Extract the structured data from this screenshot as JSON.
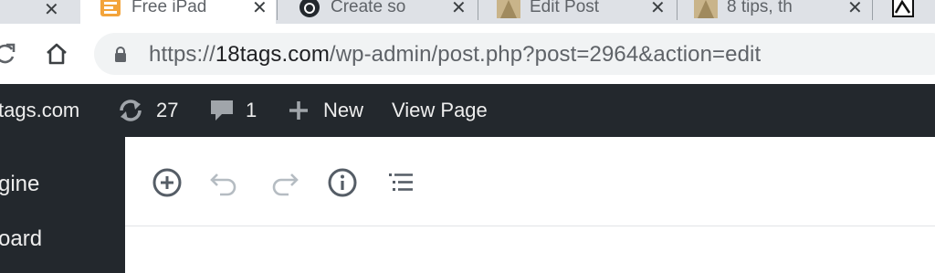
{
  "browser": {
    "tabs": [
      {
        "title": "Free iPad",
        "close": "✕"
      },
      {
        "title": "Create so",
        "close": "✕"
      },
      {
        "title": "Edit Post",
        "close": "✕"
      },
      {
        "title": "8 tips, th",
        "close": "✕"
      }
    ],
    "url": {
      "scheme": "https://",
      "host": "18tags.com",
      "path": "/wp-admin/post.php?post=2964&action=edit"
    }
  },
  "adminbar": {
    "site_name": "tags.com",
    "updates_count": "27",
    "comments_count": "1",
    "new_label": "New",
    "view_label": "View Page"
  },
  "sidebar": {
    "items": [
      "gine",
      "oard"
    ]
  },
  "colors": {
    "adminbar_bg": "#23282d",
    "tabstrip_bg": "#dee1e6",
    "omnibox_bg": "#f1f3f4"
  }
}
